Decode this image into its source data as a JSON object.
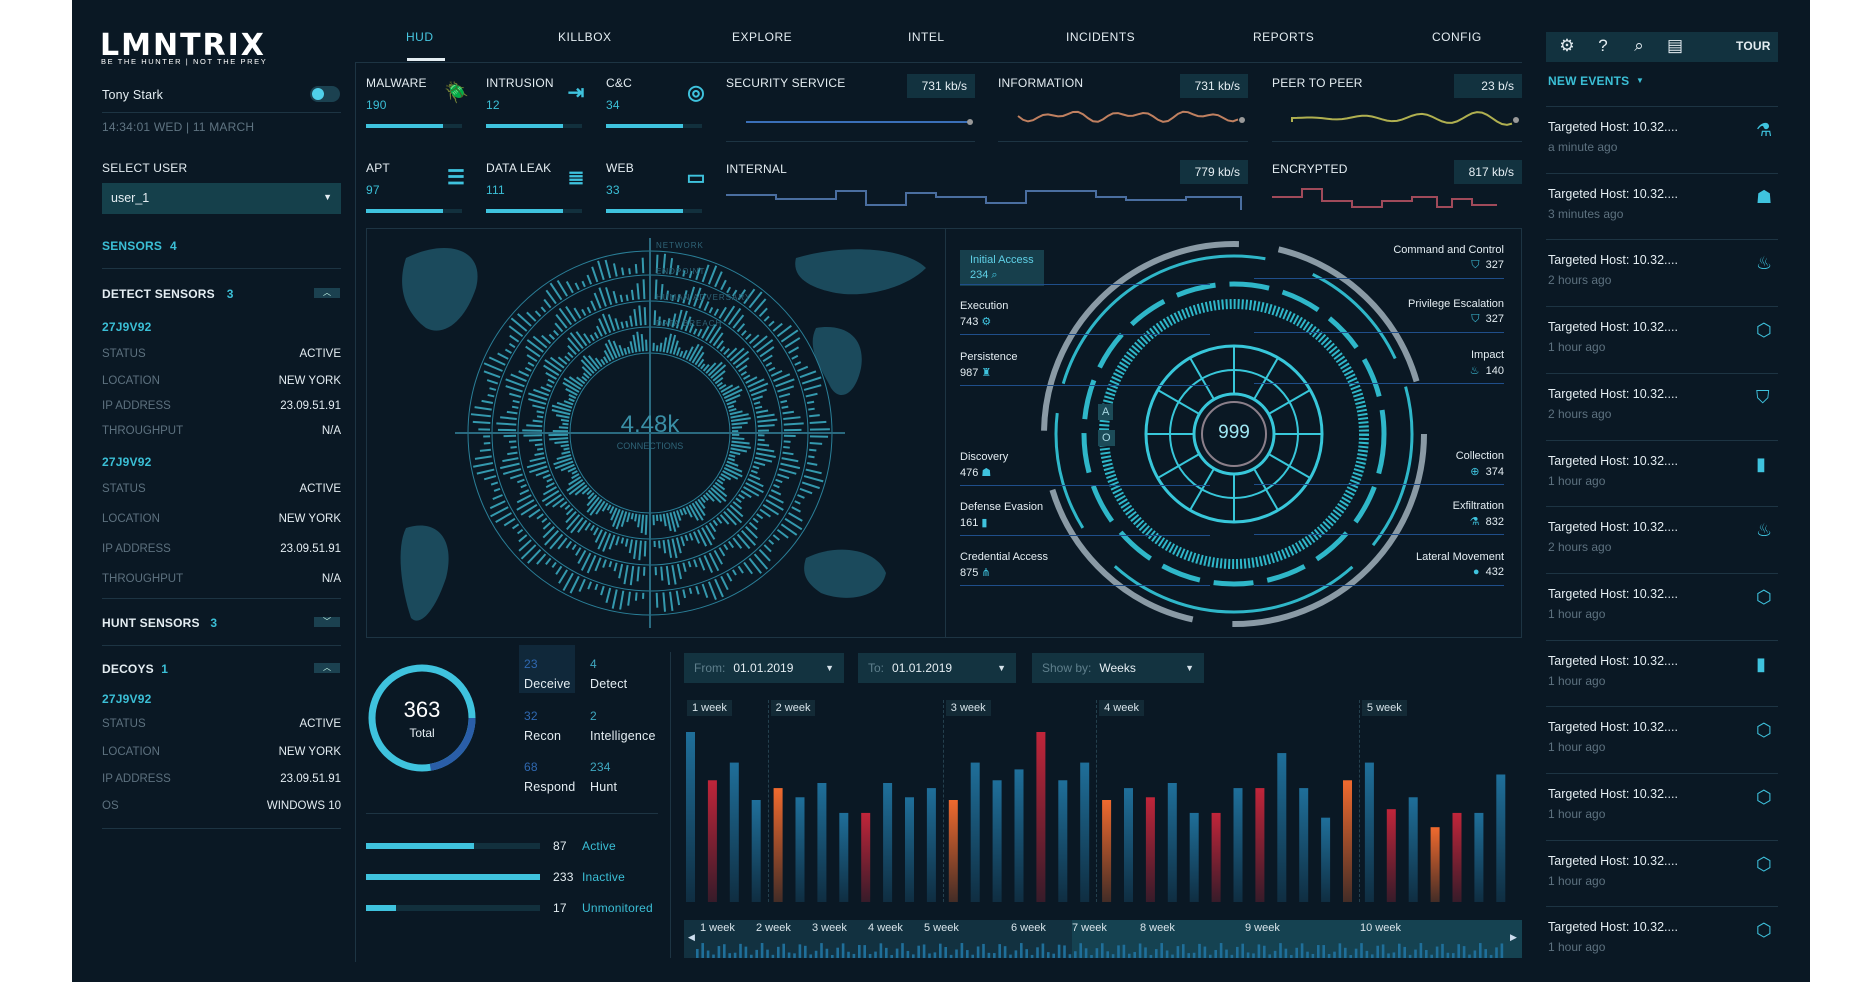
{
  "brand": {
    "logo": "LMNTRIX",
    "tagline": "BE THE HUNTER | NOT THE PREY"
  },
  "nav": {
    "tabs": [
      {
        "label": "HUD",
        "active": true
      },
      {
        "label": "KILLBOX"
      },
      {
        "label": "EXPLORE"
      },
      {
        "label": "INTEL"
      },
      {
        "label": "INCIDENTS"
      },
      {
        "label": "REPORTS"
      },
      {
        "label": "CONFIG"
      }
    ]
  },
  "user": {
    "name": "Tony Stark",
    "toggle_on": true,
    "datetime": "14:34:01 WED | 11 MARCH",
    "select_label": "SELECT USER",
    "selected": "user_1"
  },
  "sensors": {
    "label": "SENSORS",
    "count": "4",
    "detect": {
      "label": "DETECT SENSORS",
      "count": "3",
      "expanded": true,
      "items": [
        {
          "id": "27J9V92",
          "rows": [
            {
              "k": "STATUS",
              "v": "ACTIVE"
            },
            {
              "k": "LOCATION",
              "v": "NEW YORK"
            },
            {
              "k": "IP ADDRESS",
              "v": "23.09.51.91"
            },
            {
              "k": "THROUGHPUT",
              "v": "N/A"
            }
          ]
        },
        {
          "id": "27J9V92",
          "rows": [
            {
              "k": "STATUS",
              "v": "ACTIVE"
            },
            {
              "k": "LOCATION",
              "v": "NEW YORK"
            },
            {
              "k": "IP ADDRESS",
              "v": "23.09.51.91"
            },
            {
              "k": "THROUGHPUT",
              "v": "N/A"
            }
          ]
        }
      ]
    },
    "hunt": {
      "label": "HUNT SENSORS",
      "count": "3",
      "expanded": false
    },
    "decoys": {
      "label": "DECOYS",
      "count": "1",
      "expanded": true,
      "items": [
        {
          "id": "27J9V92",
          "rows": [
            {
              "k": "STATUS",
              "v": "ACTIVE"
            },
            {
              "k": "LOCATION",
              "v": "NEW YORK"
            },
            {
              "k": "IP ADDRESS",
              "v": "23.09.51.91"
            },
            {
              "k": "OS",
              "v": "WINDOWS 10"
            }
          ]
        }
      ]
    }
  },
  "threats": [
    {
      "label": "MALWARE",
      "value": "190",
      "icon": "bug-icon",
      "fill": 0.8
    },
    {
      "label": "INTRUSION",
      "value": "12",
      "icon": "door-exit-icon",
      "fill": 0.8
    },
    {
      "label": "C&C",
      "value": "34",
      "icon": "signal-icon",
      "fill": 0.8
    },
    {
      "label": "APT",
      "value": "97",
      "icon": "layers-icon",
      "fill": 0.8
    },
    {
      "label": "DATA LEAK",
      "value": "111",
      "icon": "database-icon",
      "fill": 0.8
    },
    {
      "label": "WEB",
      "value": "33",
      "icon": "monitor-icon",
      "fill": 0.8
    }
  ],
  "traffic": [
    {
      "label": "SECURITY SERVICE",
      "rate": "731 kb/s"
    },
    {
      "label": "INFORMATION",
      "rate": "731 kb/s"
    },
    {
      "label": "PEER TO PEER",
      "rate": "23 b/s"
    },
    {
      "label": "INTERNAL",
      "rate": "779 kb/s"
    },
    {
      "label": "ENCRYPTED",
      "rate": "817 kb/s"
    }
  ],
  "connections": {
    "value": "4.48k",
    "label": "CONNECTIONS",
    "rings": [
      "NETWORK",
      "ENDPOINT",
      "HUMAN ADVERSARY",
      "DATA BREACH"
    ]
  },
  "killchain": {
    "center": "999",
    "ring_letters": [
      "A",
      "O"
    ],
    "left": [
      {
        "label": "Initial Access",
        "value": "234",
        "icon": "search-icon"
      },
      {
        "label": "Execution",
        "value": "743",
        "icon": "gear-icon"
      },
      {
        "label": "Persistence",
        "value": "987",
        "icon": "user-icon"
      },
      {
        "label": "Discovery",
        "value": "476",
        "icon": "robot-icon"
      },
      {
        "label": "Defense Evasion",
        "value": "161",
        "icon": "book-icon"
      },
      {
        "label": "Credential Access",
        "value": "875",
        "icon": "network-icon"
      }
    ],
    "right": [
      {
        "label": "Command and Control",
        "value": "327",
        "icon": "shield-icon"
      },
      {
        "label": "Privilege Escalation",
        "value": "327",
        "icon": "shield-icon"
      },
      {
        "label": "Impact",
        "value": "140",
        "icon": "fire-icon"
      },
      {
        "label": "Collection",
        "value": "374",
        "icon": "crosshair-icon"
      },
      {
        "label": "Exfiltration",
        "value": "832",
        "icon": "flask-icon"
      },
      {
        "label": "Lateral Movement",
        "value": "432",
        "icon": "skull-icon"
      }
    ]
  },
  "summary": {
    "total": "363",
    "total_label": "Total",
    "categories": [
      {
        "v": "23",
        "l": "Deceive"
      },
      {
        "v": "4",
        "l": "Detect"
      },
      {
        "v": "32",
        "l": "Recon"
      },
      {
        "v": "2",
        "l": "Intelligence"
      },
      {
        "v": "68",
        "l": "Respond"
      },
      {
        "v": "234",
        "l": "Hunt"
      }
    ],
    "status": [
      {
        "v": "87",
        "l": "Active",
        "fill": 0.62
      },
      {
        "v": "233",
        "l": "Inactive",
        "fill": 1.0
      },
      {
        "v": "17",
        "l": "Unmonitored",
        "fill": 0.17
      }
    ]
  },
  "filters": {
    "from_label": "From:",
    "from": "01.01.2019",
    "to_label": "To:",
    "to": "01.01.2019",
    "show_label": "Show by:",
    "show": "Weeks"
  },
  "activity_chart": {
    "type": "bar",
    "week_labels": [
      "1 week",
      "2 week",
      "3 week",
      "4 week",
      "5 week"
    ],
    "week_starts": [
      0,
      4,
      12,
      19,
      31
    ],
    "values": [
      500,
      358,
      410,
      300,
      335,
      308,
      350,
      262,
      262,
      350,
      308,
      335,
      300,
      410,
      358,
      390,
      500,
      358,
      410,
      300,
      335,
      308,
      350,
      262,
      262,
      335,
      335,
      438,
      335,
      248,
      358,
      410,
      273,
      308,
      220,
      262,
      262,
      375
    ],
    "kinds": [
      "b",
      "r",
      "b",
      "b",
      "o",
      "b",
      "b",
      "b",
      "r",
      "b",
      "b",
      "b",
      "o",
      "b",
      "b",
      "b",
      "r",
      "b",
      "b",
      "o",
      "b",
      "r",
      "b",
      "b",
      "r",
      "b",
      "r",
      "b",
      "b",
      "b",
      "o",
      "b",
      "r",
      "b",
      "o",
      "r",
      "b",
      "b"
    ],
    "colors": {
      "b": "#1f6f9a",
      "r": "#c0253a",
      "o": "#f06a2e"
    },
    "timeline": [
      "1 week",
      "2 week",
      "3 week",
      "4 week",
      "5 week",
      "6 week",
      "7 week",
      "8 week",
      "9 week",
      "10 week"
    ]
  },
  "toolbar": {
    "icons": [
      "settings-icon",
      "help-icon",
      "search-icon",
      "document-icon"
    ],
    "tour": "TOUR"
  },
  "events": {
    "label": "NEW EVENTS",
    "items": [
      {
        "t": "Targeted Host: 10.32....",
        "s": "a minute ago",
        "icon": "flask"
      },
      {
        "t": "Targeted Host: 10.32....",
        "s": "3 minutes ago",
        "icon": "robot"
      },
      {
        "t": "Targeted Host: 10.32....",
        "s": "2 hours ago",
        "icon": "fire"
      },
      {
        "t": "Targeted Host: 10.32....",
        "s": "1 hour ago",
        "icon": "cube"
      },
      {
        "t": "Targeted Host: 10.32....",
        "s": "2 hours ago",
        "icon": "shield"
      },
      {
        "t": "Targeted Host: 10.32....",
        "s": "1 hour ago",
        "icon": "book"
      },
      {
        "t": "Targeted Host: 10.32....",
        "s": "2 hours ago",
        "icon": "fire"
      },
      {
        "t": "Targeted Host: 10.32....",
        "s": "1 hour ago",
        "icon": "cube"
      },
      {
        "t": "Targeted Host: 10.32....",
        "s": "1 hour ago",
        "icon": "book"
      },
      {
        "t": "Targeted Host: 10.32....",
        "s": "1 hour ago",
        "icon": "cube"
      },
      {
        "t": "Targeted Host: 10.32....",
        "s": "1 hour ago",
        "icon": "cube"
      },
      {
        "t": "Targeted Host: 10.32....",
        "s": "1 hour ago",
        "icon": "cube"
      },
      {
        "t": "Targeted Host: 10.32....",
        "s": "1 hour ago",
        "icon": "cube"
      }
    ]
  },
  "colors": {
    "accent": "#3fc3de",
    "background": "#0a1824",
    "panel": "#12323f"
  }
}
